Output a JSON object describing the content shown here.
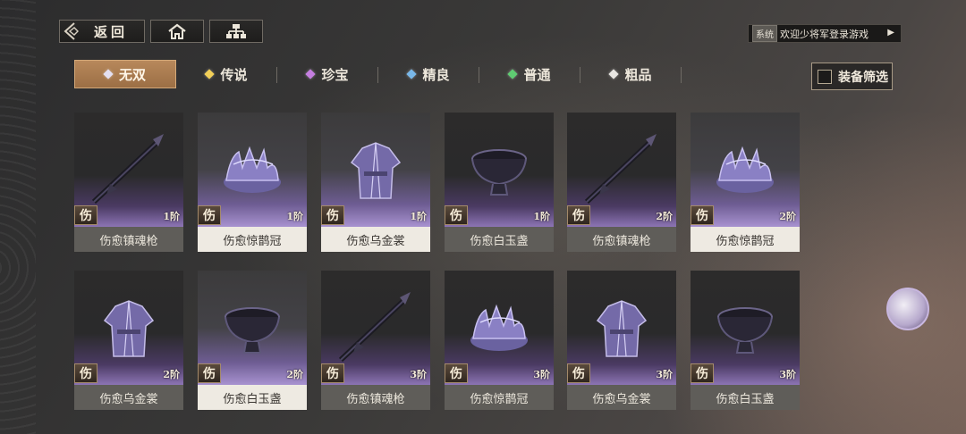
{
  "nav": {
    "back_label": "返回",
    "home_icon": "home-icon",
    "tree_icon": "hierarchy-icon"
  },
  "system": {
    "tag": "系统",
    "message": "欢迎少将军登录游戏",
    "arrow": "▶"
  },
  "tabs": [
    {
      "label": "无双",
      "gem_color": "#e4e0f2",
      "active": true
    },
    {
      "label": "传说",
      "gem_color": "#f1cf58",
      "active": false
    },
    {
      "label": "珍宝",
      "gem_color": "#c47ee0",
      "active": false
    },
    {
      "label": "精良",
      "gem_color": "#79b7e8",
      "active": false
    },
    {
      "label": "普通",
      "gem_color": "#5fcc72",
      "active": false
    },
    {
      "label": "粗品",
      "gem_color": "#e8e6e2",
      "active": false
    }
  ],
  "filter": {
    "label": "装备筛选"
  },
  "items": [
    {
      "name": "伤愈镇魂枪",
      "badge": "伤",
      "tier": "1阶",
      "lit": false,
      "kind": "spear-icon"
    },
    {
      "name": "伤愈惊鹊冠",
      "badge": "伤",
      "tier": "1阶",
      "lit": true,
      "kind": "crown-icon"
    },
    {
      "name": "伤愈乌金裳",
      "badge": "伤",
      "tier": "1阶",
      "lit": true,
      "kind": "robe-icon"
    },
    {
      "name": "伤愈白玉盏",
      "badge": "伤",
      "tier": "1阶",
      "lit": false,
      "kind": "cup-icon"
    },
    {
      "name": "伤愈镇魂枪",
      "badge": "伤",
      "tier": "2阶",
      "lit": false,
      "kind": "spear-icon"
    },
    {
      "name": "伤愈惊鹊冠",
      "badge": "伤",
      "tier": "2阶",
      "lit": true,
      "kind": "crown-icon"
    },
    {
      "name": "伤愈乌金裳",
      "badge": "伤",
      "tier": "2阶",
      "lit": false,
      "kind": "robe-icon"
    },
    {
      "name": "伤愈白玉盏",
      "badge": "伤",
      "tier": "2阶",
      "lit": true,
      "kind": "cup-icon"
    },
    {
      "name": "伤愈镇魂枪",
      "badge": "伤",
      "tier": "3阶",
      "lit": false,
      "kind": "spear-icon"
    },
    {
      "name": "伤愈惊鹊冠",
      "badge": "伤",
      "tier": "3阶",
      "lit": false,
      "kind": "crown-icon"
    },
    {
      "name": "伤愈乌金裳",
      "badge": "伤",
      "tier": "3阶",
      "lit": false,
      "kind": "robe-icon"
    },
    {
      "name": "伤愈白玉盏",
      "badge": "伤",
      "tier": "3阶",
      "lit": false,
      "kind": "cup-icon"
    }
  ]
}
